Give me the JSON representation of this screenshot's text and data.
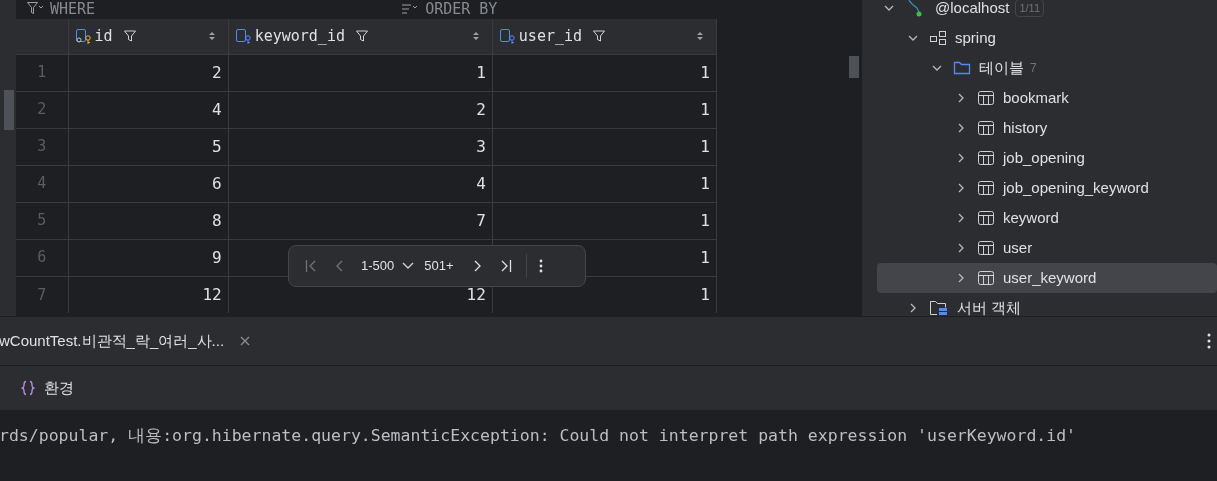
{
  "filter_bar": {
    "where": "WHERE",
    "order_by": "ORDER BY"
  },
  "grid": {
    "columns": [
      {
        "name": "id",
        "key": true
      },
      {
        "name": "keyword_id",
        "key": false
      },
      {
        "name": "user_id",
        "key": false
      }
    ],
    "rows": [
      {
        "num": "1",
        "cells": [
          "2",
          "1",
          "1"
        ]
      },
      {
        "num": "2",
        "cells": [
          "4",
          "2",
          "1"
        ]
      },
      {
        "num": "3",
        "cells": [
          "5",
          "3",
          "1"
        ]
      },
      {
        "num": "4",
        "cells": [
          "6",
          "4",
          "1"
        ]
      },
      {
        "num": "5",
        "cells": [
          "8",
          "7",
          "1"
        ]
      },
      {
        "num": "6",
        "cells": [
          "9",
          null,
          "1"
        ]
      },
      {
        "num": "7",
        "cells": [
          "12",
          "12",
          "1"
        ]
      }
    ]
  },
  "pager": {
    "range": "1-500",
    "total": "501+"
  },
  "tree": [
    {
      "label": "@localhost",
      "badge": "1/11",
      "kind": "host",
      "expanded": true,
      "selected": false,
      "children": [
        {
          "label": "spring",
          "kind": "schema",
          "expanded": true,
          "selected": false,
          "children": [
            {
              "label": "테이블",
              "count": "7",
              "kind": "folder",
              "expanded": true,
              "selected": false,
              "children": [
                {
                  "label": "bookmark",
                  "kind": "table",
                  "expanded": false,
                  "selected": false
                },
                {
                  "label": "history",
                  "kind": "table",
                  "expanded": false,
                  "selected": false
                },
                {
                  "label": "job_opening",
                  "kind": "table",
                  "expanded": false,
                  "selected": false
                },
                {
                  "label": "job_opening_keyword",
                  "kind": "table",
                  "expanded": false,
                  "selected": false
                },
                {
                  "label": "keyword",
                  "kind": "table",
                  "expanded": false,
                  "selected": false
                },
                {
                  "label": "user",
                  "kind": "table",
                  "expanded": false,
                  "selected": false
                },
                {
                  "label": "user_keyword",
                  "kind": "table",
                  "expanded": false,
                  "selected": true
                }
              ]
            }
          ]
        },
        {
          "label": "서버 객체",
          "kind": "server",
          "expanded": false,
          "selected": false
        }
      ]
    }
  ],
  "run_tab": {
    "title": "wCountTest.비관적_락_여러_사..."
  },
  "toolbar": {
    "label": "환경"
  },
  "console": {
    "line": "rds/popular, 내용:org.hibernate.query.SemanticException: Could not interpret path expression 'userKeyword.id'"
  }
}
